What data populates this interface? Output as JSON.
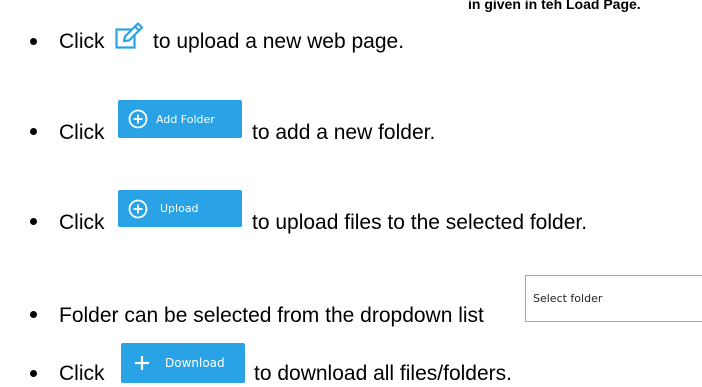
{
  "top_fragment": "in given in teh Load Page.",
  "items": [
    {
      "prefix": "Click",
      "suffix": "to upload a new web page.",
      "icon": "edit-icon"
    },
    {
      "prefix": "Click",
      "button_label": "Add Folder",
      "button_icon": "plus-circle-icon",
      "suffix": "to add a new folder."
    },
    {
      "prefix": "Click",
      "button_label": "Upload",
      "button_icon": "plus-circle-icon",
      "suffix": "to upload files to the selected folder."
    },
    {
      "text": "Folder can be selected from the dropdown list",
      "select_value": "Select folder"
    },
    {
      "prefix": "Click",
      "button_label": "Download",
      "button_icon": "plus-icon",
      "suffix": "to download all files/folders."
    }
  ],
  "colors": {
    "button_bg": "#29a3e6",
    "icon_blue": "#29a3e6",
    "select_border": "#7fb3d9"
  }
}
